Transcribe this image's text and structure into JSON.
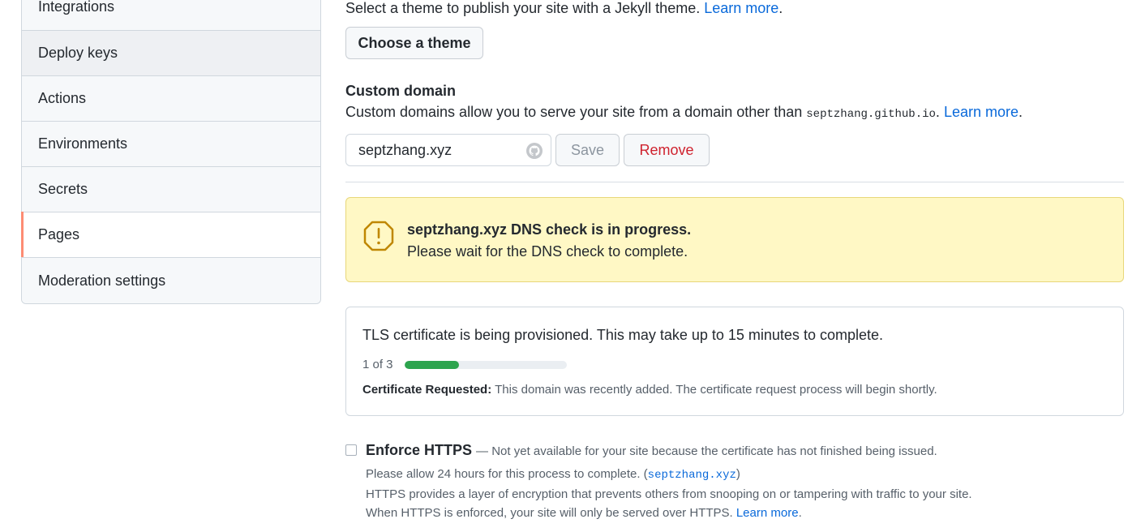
{
  "sidebar": {
    "items": [
      {
        "label": "Integrations"
      },
      {
        "label": "Deploy keys"
      },
      {
        "label": "Actions"
      },
      {
        "label": "Environments"
      },
      {
        "label": "Secrets"
      },
      {
        "label": "Pages"
      },
      {
        "label": "Moderation settings"
      }
    ],
    "selected": "Pages"
  },
  "theme": {
    "intro_text": "Select a theme to publish your site with a Jekyll theme.",
    "learn_more": "Learn more",
    "intro_end": ".",
    "choose_button": "Choose a theme"
  },
  "custom_domain": {
    "heading": "Custom domain",
    "desc_prefix": "Custom domains allow you to serve your site from a domain other than",
    "default_domain": "septzhang.github.io",
    "desc_dot": ".",
    "learn_more": "Learn more",
    "desc_end": ".",
    "input_value": "septzhang.xyz",
    "save_label": "Save",
    "remove_label": "Remove"
  },
  "dns_flash": {
    "title": "septzhang.xyz DNS check is in progress.",
    "body": "Please wait for the DNS check to complete."
  },
  "tls": {
    "title": "TLS certificate is being provisioned. This may take up to 15 minutes to complete.",
    "step_text": "1 of 3",
    "progress_fraction": 0.333,
    "status_label": "Certificate Requested:",
    "status_text": "This domain was recently added. The certificate request process will begin shortly."
  },
  "https": {
    "title": "Enforce HTTPS",
    "note": "— Not yet available for your site because the certificate has not finished being issued.",
    "line1_prefix": "Please allow 24 hours for this process to complete. (",
    "line1_domain": "septzhang.xyz",
    "line1_suffix": ")",
    "line2": "HTTPS provides a layer of encryption that prevents others from snooping on or tampering with traffic to your site.",
    "line3_prefix": "When HTTPS is enforced, your site will only be served over HTTPS.",
    "learn_more": "Learn more",
    "line3_end": "."
  },
  "colors": {
    "accent_link": "#0969da",
    "selected_marker": "#fd8c73",
    "progress": "#2da44e",
    "danger": "#cf222e",
    "flash_bg": "#fff8c5"
  },
  "icons": [
    "alert-icon",
    "github-mark-icon"
  ]
}
